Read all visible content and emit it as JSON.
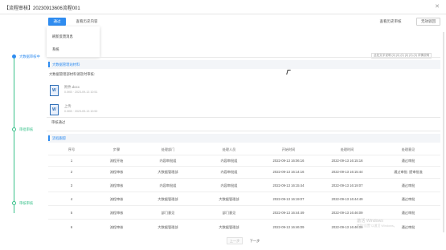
{
  "window": {
    "title": "【流程审核】20230913606流程001",
    "close_icon": "close-icon"
  },
  "toolbar": {
    "approve_label": "通过",
    "viewed_label": "查看历史内容",
    "history_label": "查看历史审核",
    "reject_label": "无效驳回"
  },
  "dropdown": {
    "options": [
      "刷新反馈消息",
      "系统"
    ]
  },
  "timeline": {
    "nodes": [
      {
        "label": "大数据审核中"
      },
      {
        "label": "审批审核"
      },
      {
        "label": "审核审核"
      }
    ]
  },
  "hint": {
    "text": "此处文字说明 (0) (0) (0) (0) (0) (0) 详情说明"
  },
  "section1": {
    "title": "大数据管理站材料",
    "desc": "大数据管理部材料请及时审核:",
    "files": [
      {
        "name": "附件.docx",
        "meta": "0.0KB · 2023-09-13 10:51"
      },
      {
        "name": "上传",
        "meta": "0.0KB · 2023-09-13 10:52"
      }
    ]
  },
  "section2": {
    "title": "",
    "desc": "审核通过"
  },
  "flow": {
    "title": "流程跟踪",
    "columns": [
      "序号",
      "步骤",
      "处理部门",
      "处理人员",
      "开始时间",
      "处理时间",
      "处理意见"
    ],
    "rows": [
      [
        "1",
        "流程开始",
        "内容审批组",
        "内容审批组",
        "2022-09-13 16:06:16",
        "2022-09-13 16:15:16",
        "通过审批"
      ],
      [
        "2",
        "流程审核",
        "大数据管理部",
        "内容审批组",
        "2022-09-13 16:14:16",
        "2022-09-13 16:15:44",
        "通过审批: 提审批准"
      ],
      [
        "3",
        "流程审核",
        "内容审批组",
        "内容审批组",
        "2022-09-13 16:15:44",
        "2022-09-13 16:19:07",
        "通过审批"
      ],
      [
        "4",
        "流程审核",
        "大数据管理部",
        "大数据管理部",
        "2022-09-13 16:19:07",
        "2022-09-13 16:44:49",
        "通过审批"
      ],
      [
        "5",
        "流程审核",
        "部门意见",
        "部门意见",
        "2022-09-13 16:44:49",
        "2022-09-13 16:46:09",
        "通过审批"
      ],
      [
        "6",
        "流程审核",
        "大数据管理部",
        "大数据管理部",
        "2022-09-13 16:46:09",
        "2022-09-13 16:46:09",
        "通过审批"
      ]
    ]
  },
  "pager": {
    "prev_label": "上一步",
    "next_label": "下一步"
  },
  "watermark": {
    "line1": "激活 Windows",
    "line2": "转到\"设置\"以激活 Windows。"
  }
}
